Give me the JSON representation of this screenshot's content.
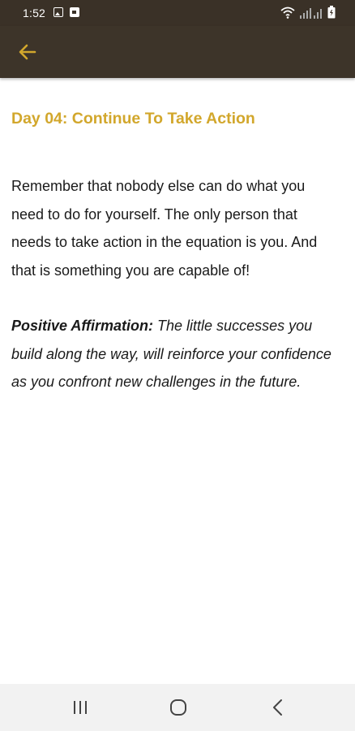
{
  "status_bar": {
    "time": "1:52",
    "icons": [
      "image-icon",
      "calendar-icon",
      "wifi-icon",
      "signal-icon",
      "battery-icon"
    ]
  },
  "app_bar": {
    "back_icon": "arrow-left-icon",
    "accent_color": "#d2a72c",
    "background_color": "#3d3429"
  },
  "article": {
    "title": "Day 04: Continue To Take Action",
    "body": "Remember that nobody else can do what you need to do for yourself. The only person that needs to take action in the equation is you. And that is something you are capable of!",
    "affirmation_label": "Positive Affirmation:",
    "affirmation_text": " The little successes you build along the way, will reinforce your confidence as you confront new challenges in the future."
  },
  "nav_bar": {
    "buttons": [
      "recents-icon",
      "home-icon",
      "back-icon"
    ]
  }
}
